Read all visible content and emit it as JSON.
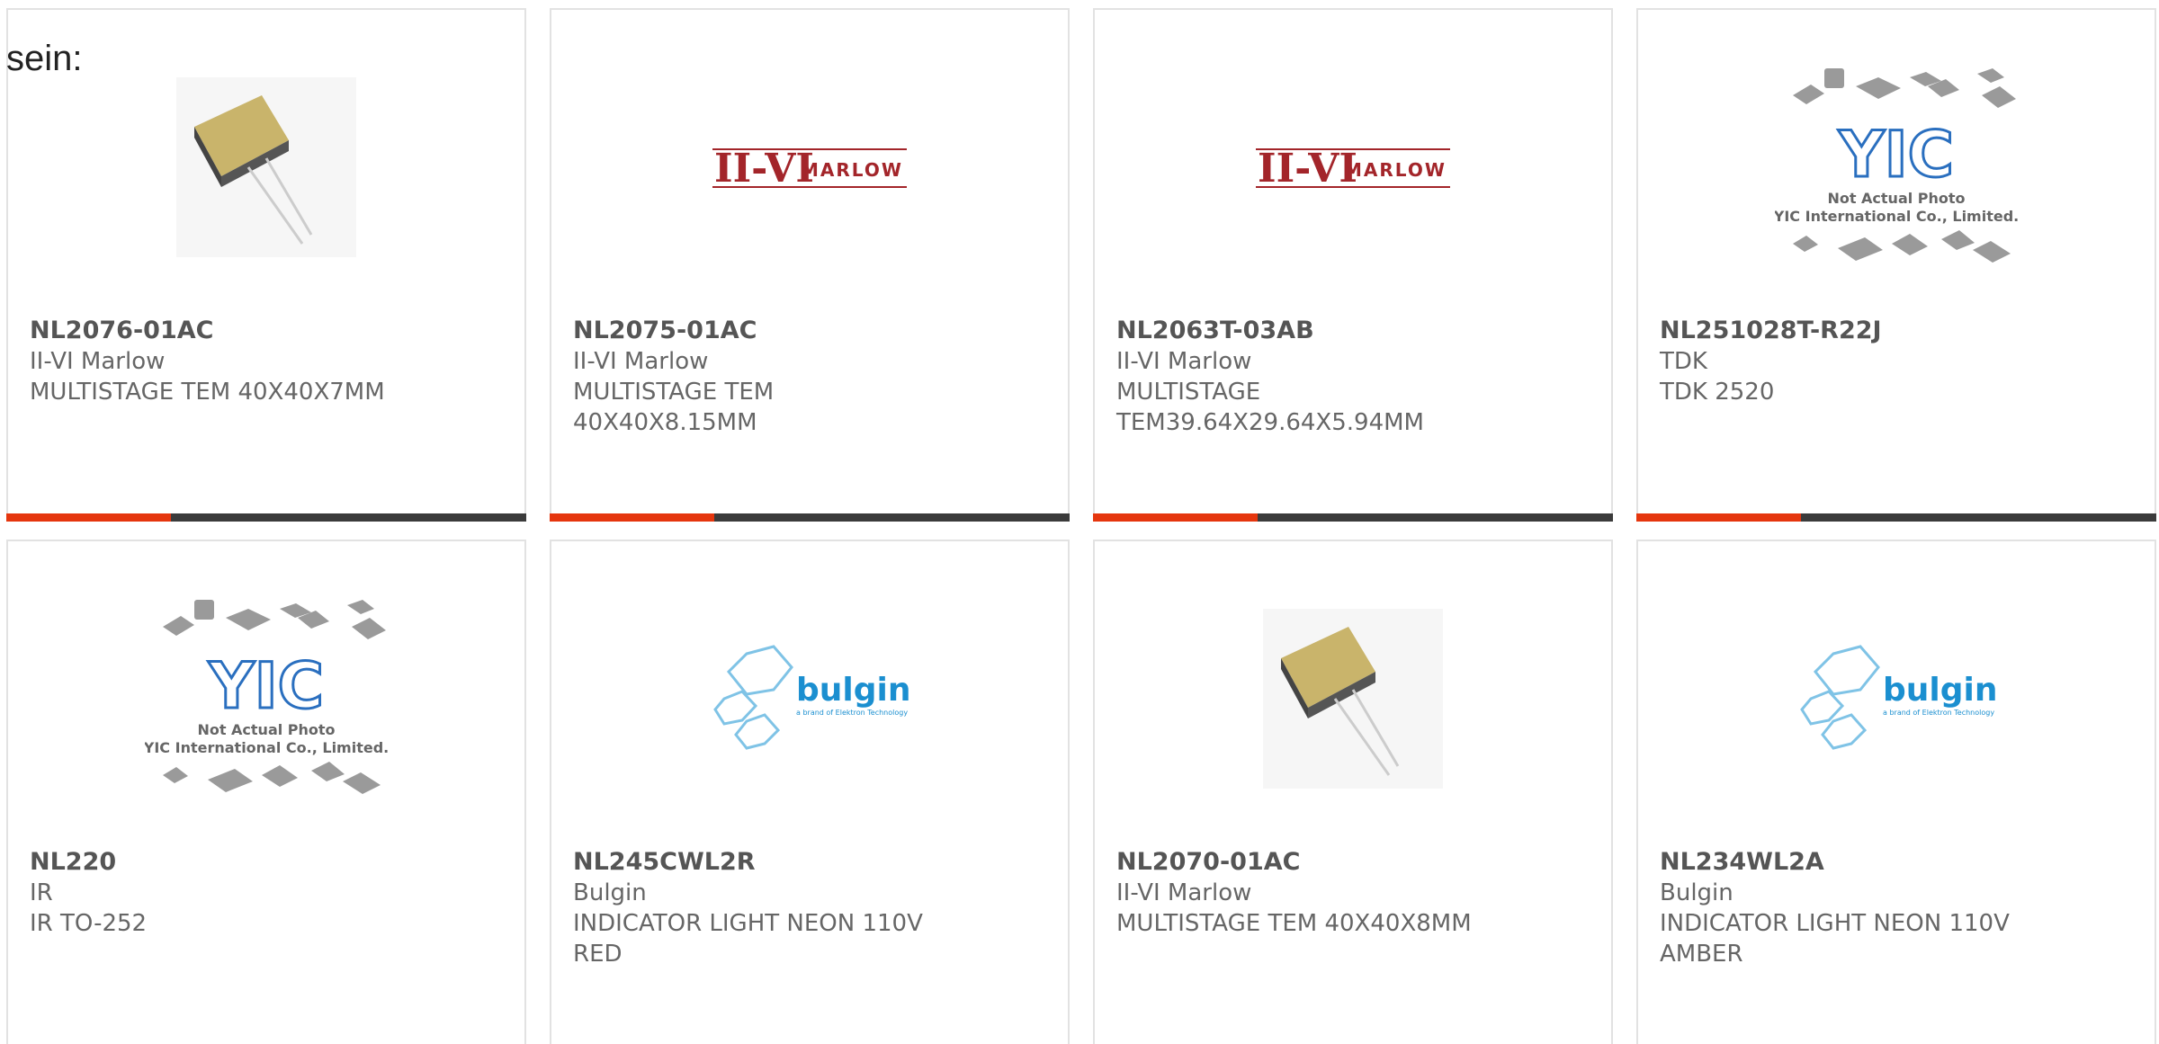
{
  "lead_text": "sein:",
  "products": [
    {
      "part_number": "NL2076-01AC",
      "manufacturer": "II-VI Marlow",
      "description": "MULTISTAGE TEM 40X40X7MM",
      "image": "tec-module-photo"
    },
    {
      "part_number": "NL2075-01AC",
      "manufacturer": "II-VI Marlow",
      "description": "MULTISTAGE TEM 40X40X8.15MM",
      "image": "ii-vi-marlow-logo"
    },
    {
      "part_number": "NL2063T-03AB",
      "manufacturer": "II-VI Marlow",
      "description": "MULTISTAGE TEM39.64X29.64X5.94MM",
      "image": "ii-vi-marlow-logo"
    },
    {
      "part_number": "NL251028T-R22J",
      "manufacturer": "TDK",
      "description": "TDK 2520",
      "image": "yic-placeholder"
    },
    {
      "part_number": "NL220",
      "manufacturer": "IR",
      "description": "IR TO-252",
      "image": "yic-placeholder"
    },
    {
      "part_number": "NL245CWL2R",
      "manufacturer": "Bulgin",
      "description": "INDICATOR LIGHT NEON 110V RED",
      "image": "bulgin-logo"
    },
    {
      "part_number": "NL2070-01AC",
      "manufacturer": "II-VI Marlow",
      "description": "MULTISTAGE TEM 40X40X8MM",
      "image": "tec-module-photo"
    },
    {
      "part_number": "NL234WL2A",
      "manufacturer": "Bulgin",
      "description": "INDICATOR LIGHT NEON 110V AMBER",
      "image": "bulgin-logo"
    }
  ],
  "logos": {
    "marlow_mark": "II-VI",
    "marlow_word": "MARLOW",
    "yic_line1": "Not Actual Photo",
    "yic_line2": "YIC International Co., Limited.",
    "bulgin_word": "bulgin",
    "bulgin_tag": "a brand of Elektron Technology"
  },
  "colors": {
    "accent": "#e5360e",
    "bar": "#3b3b3b",
    "marlow_red": "#a3252a",
    "yic_blue": "#2a6fbf",
    "bulgin_blue": "#1b8fd0"
  }
}
